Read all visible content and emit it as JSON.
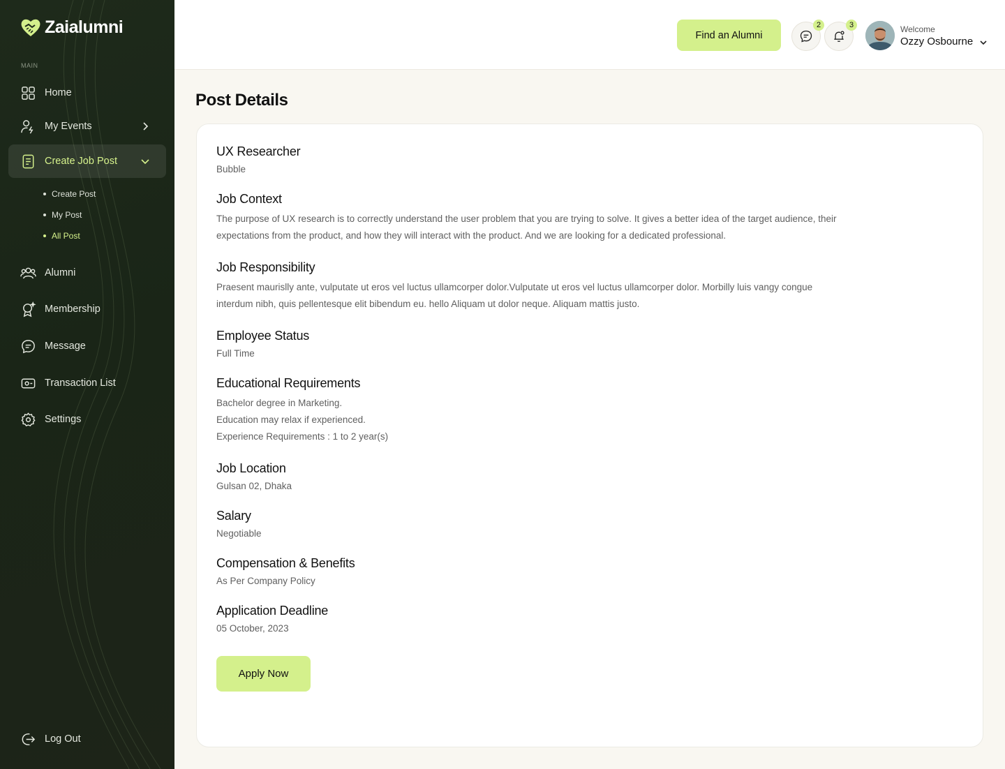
{
  "app": {
    "name": "Zaialumni"
  },
  "sidebar": {
    "section_label": "MAIN",
    "items": [
      {
        "label": "Home",
        "icon": "grid-icon"
      },
      {
        "label": "My Events",
        "icon": "user-lightning-icon"
      },
      {
        "label": "Create Job Post",
        "icon": "document-icon"
      },
      {
        "label": "Alumni",
        "icon": "users-icon"
      },
      {
        "label": "Membership",
        "icon": "badge-icon"
      },
      {
        "label": "Message",
        "icon": "message-icon"
      },
      {
        "label": "Transaction List",
        "icon": "wallet-icon"
      },
      {
        "label": "Settings",
        "icon": "gear-icon"
      }
    ],
    "sub_items": [
      {
        "label": "Create Post"
      },
      {
        "label": "My Post"
      },
      {
        "label": "All Post"
      }
    ],
    "logout": "Log Out"
  },
  "header": {
    "find_button": "Find an Alumni",
    "message_count": "2",
    "notification_count": "3",
    "welcome": "Welcome",
    "user_name": "Ozzy Osbourne"
  },
  "colors": {
    "accent": "#d4f08c",
    "sidebar_bg": "#1e2a1b",
    "page_bg": "#f9f7f1"
  },
  "page": {
    "title": "Post Details"
  },
  "post": {
    "job_title": "UX Researcher",
    "company": "Bubble",
    "context_heading": "Job Context",
    "context_text": "The purpose of UX research is to correctly understand the user problem that you are trying to solve. It gives a better idea of the target audience, their expectations from the product, and how they will interact with the product. And we are looking for a dedicated professional.",
    "responsibility_heading": "Job Responsibility",
    "responsibility_text": "Praesent maurislly ante, vulputate ut eros vel luctus ullamcorper dolor.Vulputate ut eros vel luctus ullamcorper dolor. Morbilly luis vangy congue interdum nibh, quis pellentesque elit bibendum eu. hello Aliquam ut dolor neque. Aliquam mattis justo.",
    "status_heading": "Employee Status",
    "status_text": "Full Time",
    "education_heading": "Educational Requirements",
    "education_lines": [
      "Bachelor degree in Marketing.",
      "Education may relax if experienced.",
      "Experience Requirements : 1 to 2 year(s)"
    ],
    "location_heading": "Job Location",
    "location_text": "Gulsan 02, Dhaka",
    "salary_heading": "Salary",
    "salary_text": "Negotiable",
    "benefits_heading": "Compensation & Benefits",
    "benefits_text": "As Per Company Policy",
    "deadline_heading": "Application Deadline",
    "deadline_text": "05 October, 2023",
    "apply_button": "Apply Now"
  }
}
